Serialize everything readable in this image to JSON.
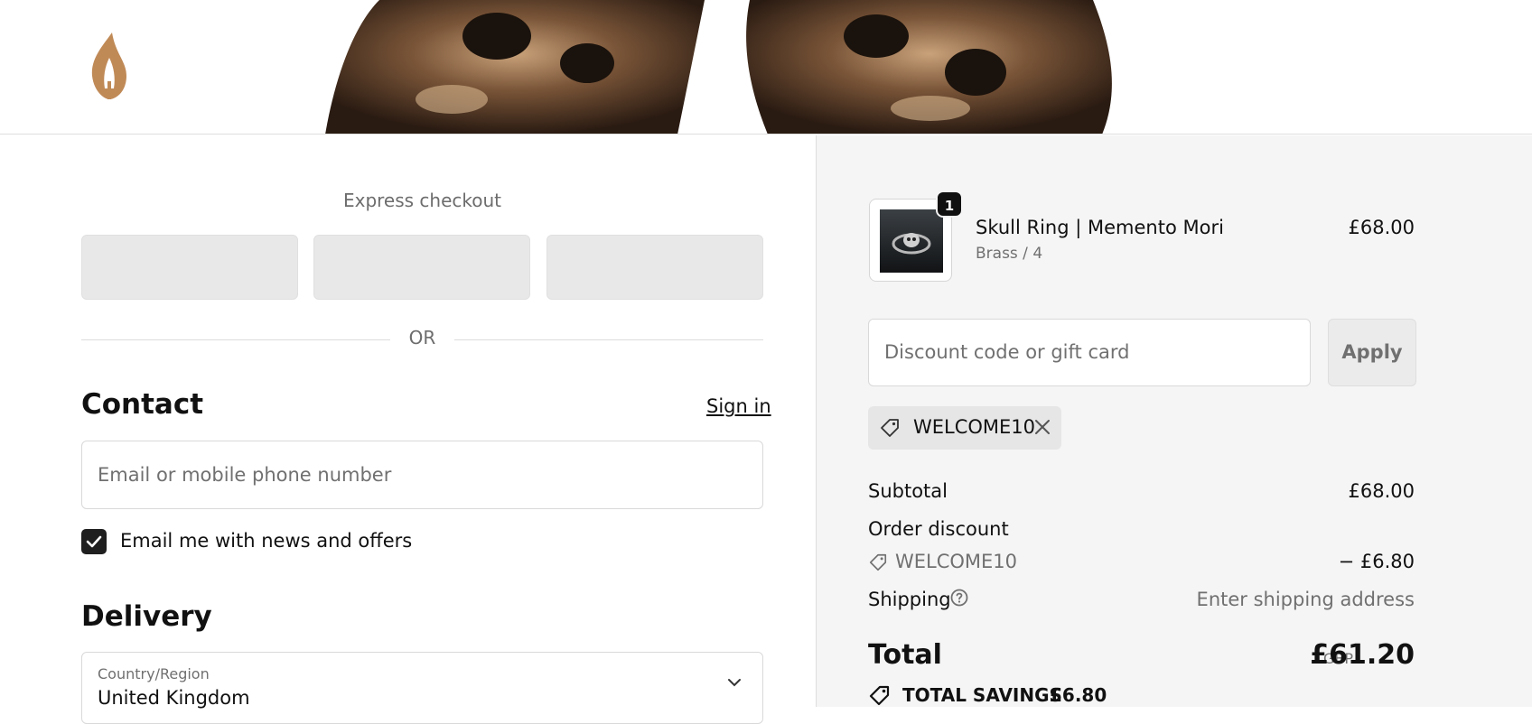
{
  "header": {
    "logo_icon": "flame-leaf-logo",
    "banner_image": "skull-ring-closeup"
  },
  "express": {
    "title": "Express checkout",
    "buttons": [
      "",
      "",
      ""
    ],
    "or_text": "OR"
  },
  "contact": {
    "heading": "Contact",
    "sign_in": "Sign in",
    "email_placeholder": "Email or mobile phone number",
    "newsletter_label": "Email me with news and offers",
    "newsletter_checked": true
  },
  "delivery": {
    "heading": "Delivery",
    "country_label": "Country/Region",
    "country_value": "United Kingdom"
  },
  "order": {
    "item": {
      "quantity": "1",
      "name": "Skull Ring | Memento Mori",
      "variant": "Brass / 4",
      "price": "£68.00"
    },
    "discount_placeholder": "Discount code or gift card",
    "apply_label": "Apply",
    "applied_code": "WELCOME10",
    "subtotal_label": "Subtotal",
    "subtotal_value": "£68.00",
    "order_discount_label": "Order discount",
    "discount_code": "WELCOME10",
    "discount_value": "− £6.80",
    "shipping_label": "Shipping",
    "shipping_value": "Enter shipping address",
    "total_label": "Total",
    "total_currency": "GBP",
    "total_value": "£61.20",
    "savings_label": "TOTAL SAVINGS",
    "savings_value": "£6.80"
  },
  "colors": {
    "summary_bg": "#f5f5f5",
    "logo": "#c08a57",
    "checkbox": "#1f1f1f"
  }
}
